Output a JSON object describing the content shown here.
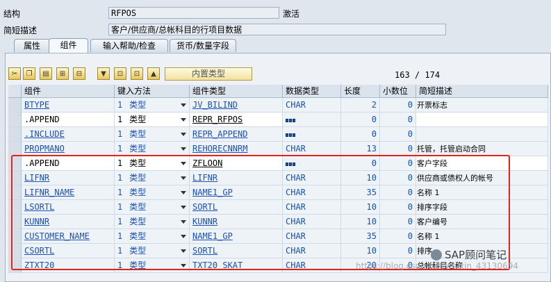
{
  "header": {
    "structure_label": "结构",
    "structure_value": "RFPOS",
    "status": "激活",
    "desc_label": "简短描述",
    "desc_value": "客户/供应商/总帐科目的行项目数据"
  },
  "tabs": [
    {
      "label": "属性"
    },
    {
      "label": "组件"
    },
    {
      "label": "输入帮助/检查"
    },
    {
      "label": "货币/数量字段"
    }
  ],
  "toolbar": {
    "icons": [
      "cut-icon",
      "copy-icon",
      "paste-icon",
      "insert-row-icon",
      "delete-row-icon",
      "find-icon",
      "first-page-icon",
      "prev-page-icon",
      "next-page-icon"
    ],
    "builtin_type_label": "内置类型",
    "pager_current": "163",
    "pager_sep": "/",
    "pager_total": "174"
  },
  "columns": [
    "组件",
    "键入方法",
    "组件类型",
    "数据类型",
    "长度",
    "小数位",
    "简短描述"
  ],
  "rows": [
    {
      "component": "BTYPE",
      "type_count": "1",
      "type_method": "类型",
      "comp_type": "JV_BILIND",
      "data_type": "CHAR",
      "length": "2",
      "decimals": "0",
      "desc": "开票标志"
    },
    {
      "component": ".APPEND",
      "type_count": "1",
      "type_method": "类型",
      "comp_type": "REPR_RFPOS",
      "data_type": "",
      "length": "0",
      "decimals": "0",
      "desc": ""
    },
    {
      "component": ".INCLUDE",
      "type_count": "1",
      "type_method": "类型",
      "comp_type": "REPR_APPEND",
      "data_type": "",
      "length": "0",
      "decimals": "0",
      "desc": ""
    },
    {
      "component": "PROPMANO",
      "type_count": "1",
      "type_method": "类型",
      "comp_type": "REHORECNNRM",
      "data_type": "CHAR",
      "length": "13",
      "decimals": "0",
      "desc": "托管，托管启动合同"
    },
    {
      "component": ".APPEND",
      "type_count": "1",
      "type_method": "类型",
      "comp_type": "ZFLOON",
      "data_type": "",
      "length": "0",
      "decimals": "0",
      "desc": "客户字段"
    },
    {
      "component": "LIFNR",
      "type_count": "1",
      "type_method": "类型",
      "comp_type": "LIFNR",
      "data_type": "CHAR",
      "length": "10",
      "decimals": "0",
      "desc": "供应商或债权人的帐号"
    },
    {
      "component": "LIFNR_NAME",
      "type_count": "1",
      "type_method": "类型",
      "comp_type": "NAME1_GP",
      "data_type": "CHAR",
      "length": "35",
      "decimals": "0",
      "desc": "名称 1"
    },
    {
      "component": "LSORTL",
      "type_count": "1",
      "type_method": "类型",
      "comp_type": "SORTL",
      "data_type": "CHAR",
      "length": "10",
      "decimals": "0",
      "desc": "排序字段"
    },
    {
      "component": "KUNNR",
      "type_count": "1",
      "type_method": "类型",
      "comp_type": "KUNNR",
      "data_type": "CHAR",
      "length": "10",
      "decimals": "0",
      "desc": "客户编号"
    },
    {
      "component": "CUSTOMER_NAME",
      "type_count": "1",
      "type_method": "类型",
      "comp_type": "NAME1_GP",
      "data_type": "CHAR",
      "length": "35",
      "decimals": "0",
      "desc": "名称 1"
    },
    {
      "component": "CSORTL",
      "type_count": "1",
      "type_method": "类型",
      "comp_type": "SORTL",
      "data_type": "CHAR",
      "length": "10",
      "decimals": "0",
      "desc": "排序"
    },
    {
      "component": "ZTXT20",
      "type_count": "1",
      "type_method": "类型",
      "comp_type": "TXT20_SKAT",
      "data_type": "CHAR",
      "length": "20",
      "decimals": "0",
      "desc": "总帐科目名称"
    }
  ],
  "watermark": {
    "text": "SAP顾问笔记",
    "blog": "https://blog.csdn.net/weixin_43130694"
  },
  "colors": {
    "highlight_box": "#e2231a",
    "link": "#1a50b8"
  }
}
